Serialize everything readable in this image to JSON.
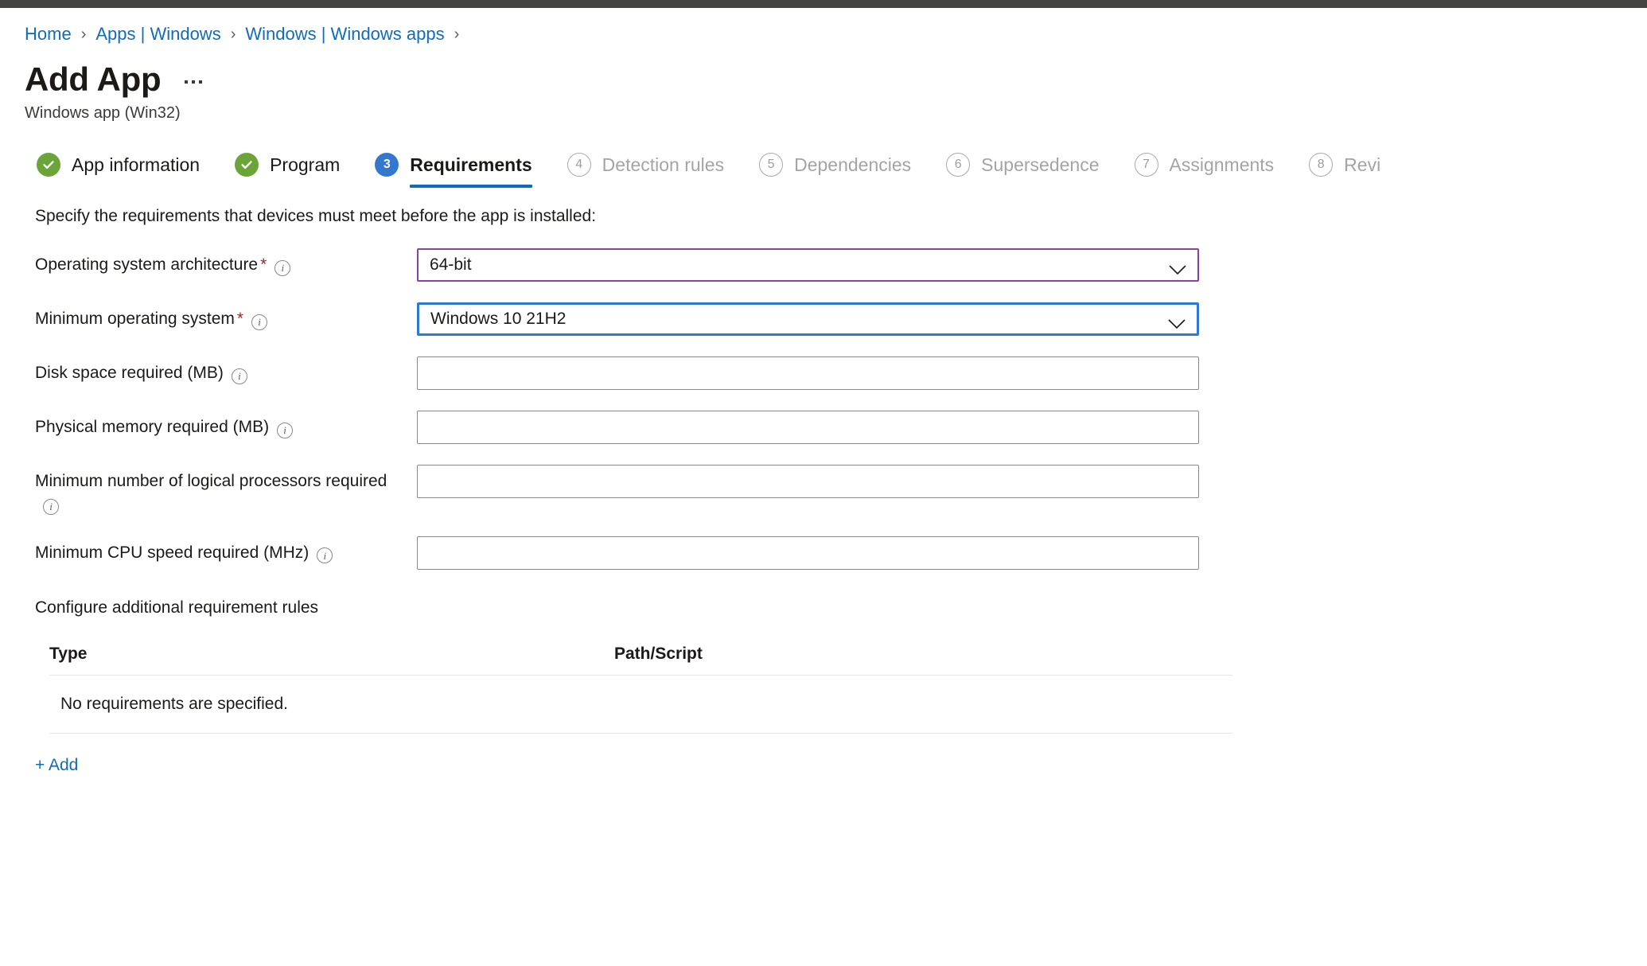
{
  "breadcrumb": {
    "separator": "›",
    "items": [
      {
        "label": "Home"
      },
      {
        "label": "Apps | Windows"
      },
      {
        "label": "Windows | Windows apps"
      }
    ]
  },
  "header": {
    "title": "Add App",
    "subtitle": "Windows app (Win32)",
    "more_menu": "…"
  },
  "steps": [
    {
      "label": "App information",
      "badge": "✓",
      "state": "done"
    },
    {
      "label": "Program",
      "badge": "✓",
      "state": "done"
    },
    {
      "label": "Requirements",
      "badge": "3",
      "state": "active"
    },
    {
      "label": "Detection rules",
      "badge": "4",
      "state": "todo"
    },
    {
      "label": "Dependencies",
      "badge": "5",
      "state": "todo"
    },
    {
      "label": "Supersedence",
      "badge": "6",
      "state": "todo"
    },
    {
      "label": "Assignments",
      "badge": "7",
      "state": "todo"
    },
    {
      "label": "Revi",
      "badge": "8",
      "state": "todo"
    }
  ],
  "main": {
    "instruction": "Specify the requirements that devices must meet before the app is installed:",
    "fields": [
      {
        "label": "Operating system architecture",
        "required": "*",
        "info": "i",
        "type": "select",
        "value": "64-bit",
        "border": "visited"
      },
      {
        "label": "Minimum operating system",
        "required": "*",
        "info": "i",
        "type": "select",
        "value": "Windows 10 21H2",
        "border": "focused"
      },
      {
        "label": "Disk space required (MB)",
        "info": "i",
        "type": "text",
        "value": "",
        "placeholder": ""
      },
      {
        "label": "Physical memory required (MB)",
        "info": "i",
        "type": "text",
        "value": "",
        "placeholder": ""
      },
      {
        "label": "Minimum number of logical processors required",
        "info": "i",
        "type": "text",
        "value": "",
        "placeholder": ""
      },
      {
        "label": "Minimum CPU speed required (MHz)",
        "info": "i",
        "type": "text",
        "value": "",
        "placeholder": ""
      }
    ],
    "rules_section_title": "Configure additional requirement rules",
    "rules_table": {
      "columns": [
        "Type",
        "Path/Script"
      ],
      "empty_text": "No requirements are specified.",
      "rows": []
    },
    "add_label": "+ Add"
  },
  "colors": {
    "link": "#0f6cbd",
    "accent_blue": "#3478ce",
    "done_green": "#6ba539",
    "visited_purple": "#8b3fa8",
    "required_red": "#a4262c",
    "topbar": "#444442"
  }
}
